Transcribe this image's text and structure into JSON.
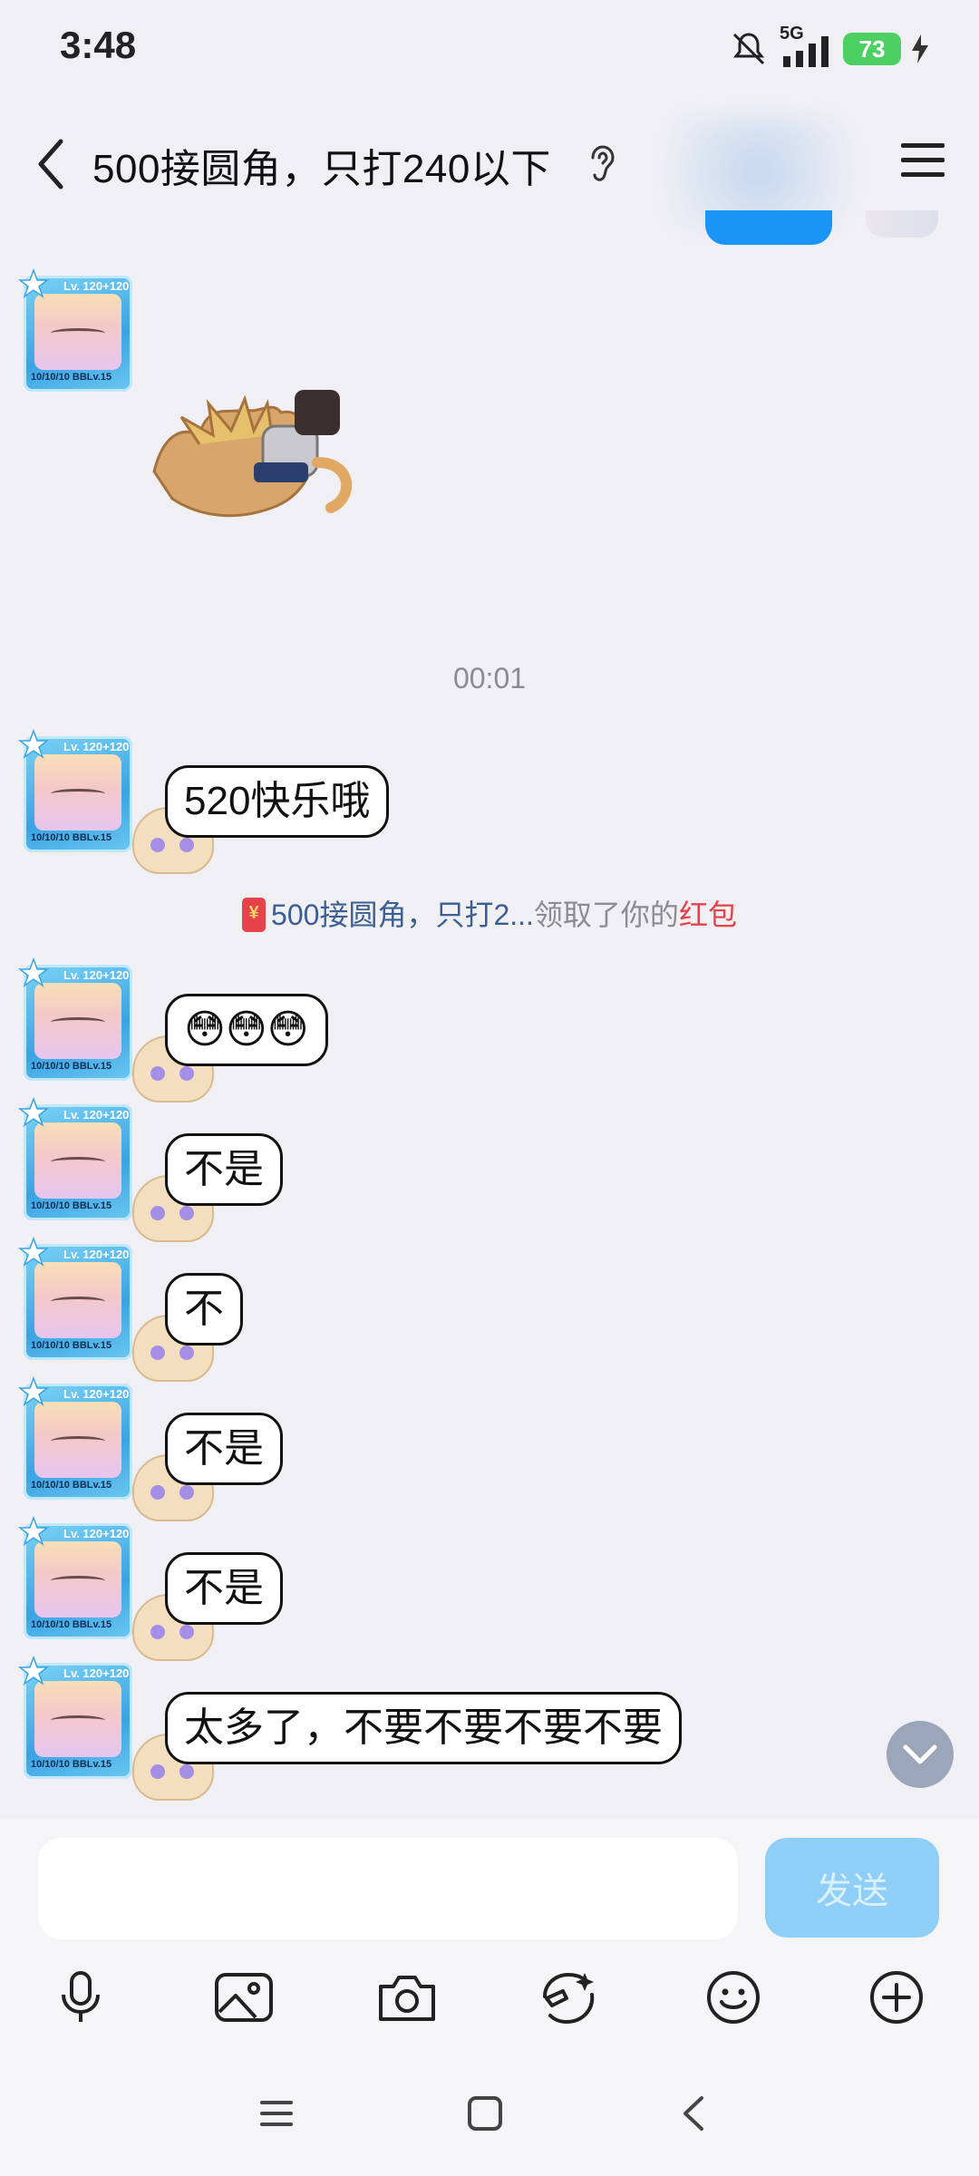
{
  "status_bar": {
    "time": "3:48",
    "network": "5G",
    "battery_level": "73",
    "icons": [
      "mute-icon",
      "signal-icon",
      "battery-icon",
      "charging-icon"
    ]
  },
  "header": {
    "title": "500接圆角，只打240以下",
    "icons": [
      "back-icon",
      "ear-icon",
      "menu-icon"
    ]
  },
  "chat": {
    "timestamp": "00:01",
    "red_packet_notice": {
      "name": "500接圆角，只打2...",
      "middle_text": "领取了你的",
      "link_text": "红包"
    },
    "messages": [
      {
        "type": "sticker",
        "description": "sticker"
      },
      {
        "type": "text",
        "text": "520快乐哦"
      },
      {
        "type": "text",
        "text": "😳😳😳"
      },
      {
        "type": "text",
        "text": "不是"
      },
      {
        "type": "text",
        "text": "不"
      },
      {
        "type": "text",
        "text": "不是"
      },
      {
        "type": "text",
        "text": "不是"
      },
      {
        "type": "text",
        "text": "太多了，不要不要不要不要"
      }
    ],
    "avatar_frame": {
      "level": "Lv. 120+120",
      "footer": "10/10/10 BBLv.15"
    }
  },
  "input_bar": {
    "placeholder": "",
    "send_label": "发送",
    "tools": [
      "mic-icon",
      "image-icon",
      "camera-icon",
      "sticker-icon",
      "emoji-icon",
      "plus-icon"
    ]
  },
  "nav_bar": {
    "icons": [
      "recent-apps-icon",
      "home-icon",
      "back-nav-icon"
    ]
  },
  "colors": {
    "background": "#efeff4",
    "accent_blue": "#1a95f7",
    "send_disabled": "#8fcff7",
    "red_packet": "#e6424a",
    "name_blue": "#3b5f93"
  }
}
